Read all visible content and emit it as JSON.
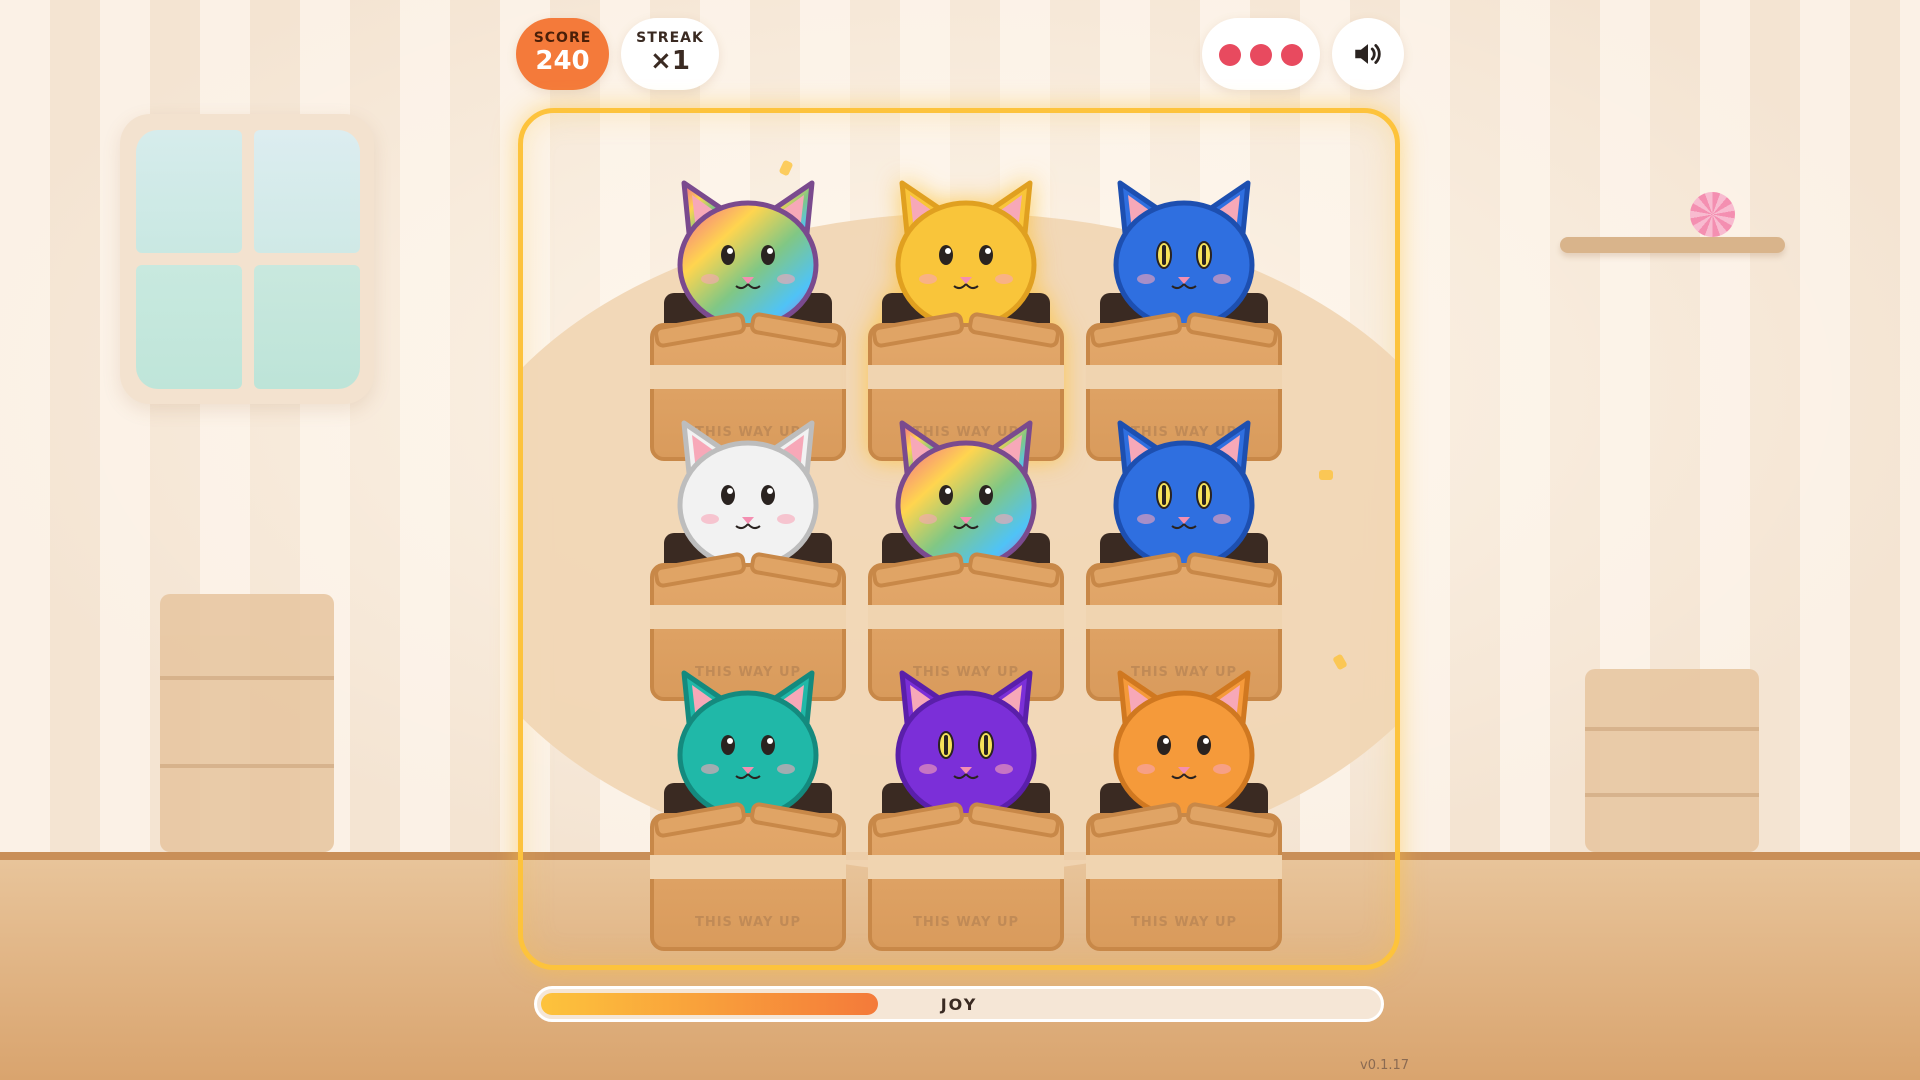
{
  "hud": {
    "score_label": "SCORE",
    "score_value": "240",
    "streak_label": "STREAK",
    "streak_value": "×1",
    "lives": 3,
    "sound_icon": "speaker-volume-icon"
  },
  "joy_meter": {
    "label": "JOY",
    "fill_fraction": 0.4
  },
  "version": "v0.1.17",
  "box_text": "THIS WAY UP",
  "colors": {
    "accent": "#fdc33c",
    "score_bg": "#f47a3a",
    "life": "#e84a5f"
  },
  "grid": [
    {
      "cat": "rainbow",
      "body": "rainbow",
      "outline": "#7a4a8e",
      "eyes": "round"
    },
    {
      "cat": "yellow",
      "body": "#f9c53a",
      "outline": "#e0a020",
      "eyes": "round",
      "highlight": true
    },
    {
      "cat": "blue",
      "body": "#2f6fe0",
      "outline": "#1d4fb0",
      "eyes": "slit"
    },
    {
      "cat": "white",
      "body": "#f2f2f2",
      "outline": "#bdbdbd",
      "eyes": "round"
    },
    {
      "cat": "rainbow",
      "body": "rainbow",
      "outline": "#7a4a8e",
      "eyes": "round"
    },
    {
      "cat": "blue",
      "body": "#2f6fe0",
      "outline": "#1d4fb0",
      "eyes": "slit"
    },
    {
      "cat": "teal",
      "body": "#20b8a8",
      "outline": "#148a7e",
      "eyes": "round"
    },
    {
      "cat": "purple",
      "body": "#7b2fd8",
      "outline": "#5a1faa",
      "eyes": "slit"
    },
    {
      "cat": "orange",
      "body": "#f59a3a",
      "outline": "#d07820",
      "eyes": "round"
    }
  ]
}
